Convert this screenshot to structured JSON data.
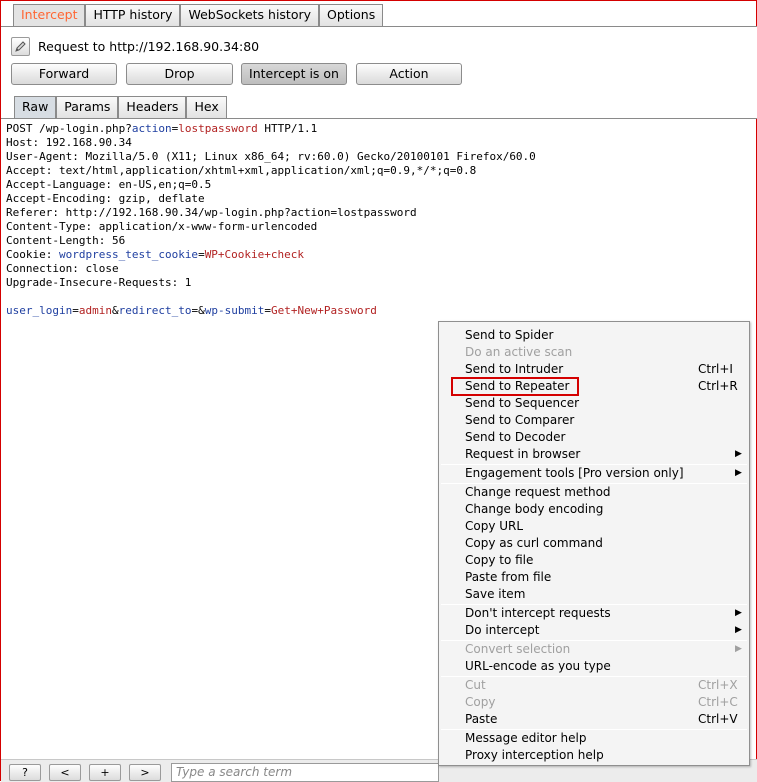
{
  "tabs": [
    {
      "label": "Intercept",
      "active": true
    },
    {
      "label": "HTTP history"
    },
    {
      "label": "WebSockets history"
    },
    {
      "label": "Options"
    }
  ],
  "request_label": "Request to http://192.168.90.34:80",
  "buttons": {
    "forward": "Forward",
    "drop": "Drop",
    "intercept": "Intercept is on",
    "action": "Action"
  },
  "subtabs": [
    "Raw",
    "Params",
    "Headers",
    "Hex"
  ],
  "request": {
    "line1": {
      "a": "POST /wp-login.php?",
      "k": "action",
      "eq": "=",
      "v": "lostpassword",
      "b": " HTTP/1.1"
    },
    "host": "Host: 192.168.90.34",
    "ua": "User-Agent: Mozilla/5.0 (X11; Linux x86_64; rv:60.0) Gecko/20100101 Firefox/60.0",
    "accept": "Accept: text/html,application/xhtml+xml,application/xml;q=0.9,*/*;q=0.8",
    "lang": "Accept-Language: en-US,en;q=0.5",
    "enc": "Accept-Encoding: gzip, deflate",
    "referer": "Referer: http://192.168.90.34/wp-login.php?action=lostpassword",
    "ctype": "Content-Type: application/x-www-form-urlencoded",
    "clen": "Content-Length: 56",
    "cookie": {
      "a": "Cookie: ",
      "k": "wordpress_test_cookie",
      "eq": "=",
      "v": "WP+Cookie+check"
    },
    "conn": "Connection: close",
    "upg": "Upgrade-Insecure-Requests: 1",
    "body": {
      "k1": "user_login",
      "v1": "admin",
      "amp1": "&",
      "k2": "redirect_to",
      "eq2": "=",
      "amp2": "&",
      "k3": "wp-submit",
      "v3": "Get+New+Password",
      "eq": "="
    }
  },
  "bottom": {
    "help": "?",
    "prev": "<",
    "add": "+",
    "next": ">",
    "search_placeholder": "Type a search term"
  },
  "menu": {
    "send_spider": "Send to Spider",
    "active_scan": "Do an active scan",
    "send_intruder": "Send to Intruder",
    "intruder_sc": "Ctrl+I",
    "send_repeater": "Send to Repeater",
    "repeater_sc": "Ctrl+R",
    "send_sequencer": "Send to Sequencer",
    "send_comparer": "Send to Comparer",
    "send_decoder": "Send to Decoder",
    "request_browser": "Request in browser",
    "engagement": "Engagement tools [Pro version only]",
    "change_method": "Change request method",
    "change_encoding": "Change body encoding",
    "copy_url": "Copy URL",
    "copy_curl": "Copy as curl command",
    "copy_file": "Copy to file",
    "paste_file": "Paste from file",
    "save_item": "Save item",
    "dont_intercept": "Don't intercept requests",
    "do_intercept": "Do intercept",
    "convert": "Convert selection",
    "url_encode": "URL-encode as you type",
    "cut": "Cut",
    "cut_sc": "Ctrl+X",
    "copy": "Copy",
    "copy_sc": "Ctrl+C",
    "paste": "Paste",
    "paste_sc": "Ctrl+V",
    "editor_help": "Message editor help",
    "proxy_help": "Proxy interception help"
  },
  "colors": {
    "accent_tab": "#ff6633",
    "highlight": "#d40000",
    "param_key": "#1f3fa0",
    "param_value": "#b22222"
  }
}
